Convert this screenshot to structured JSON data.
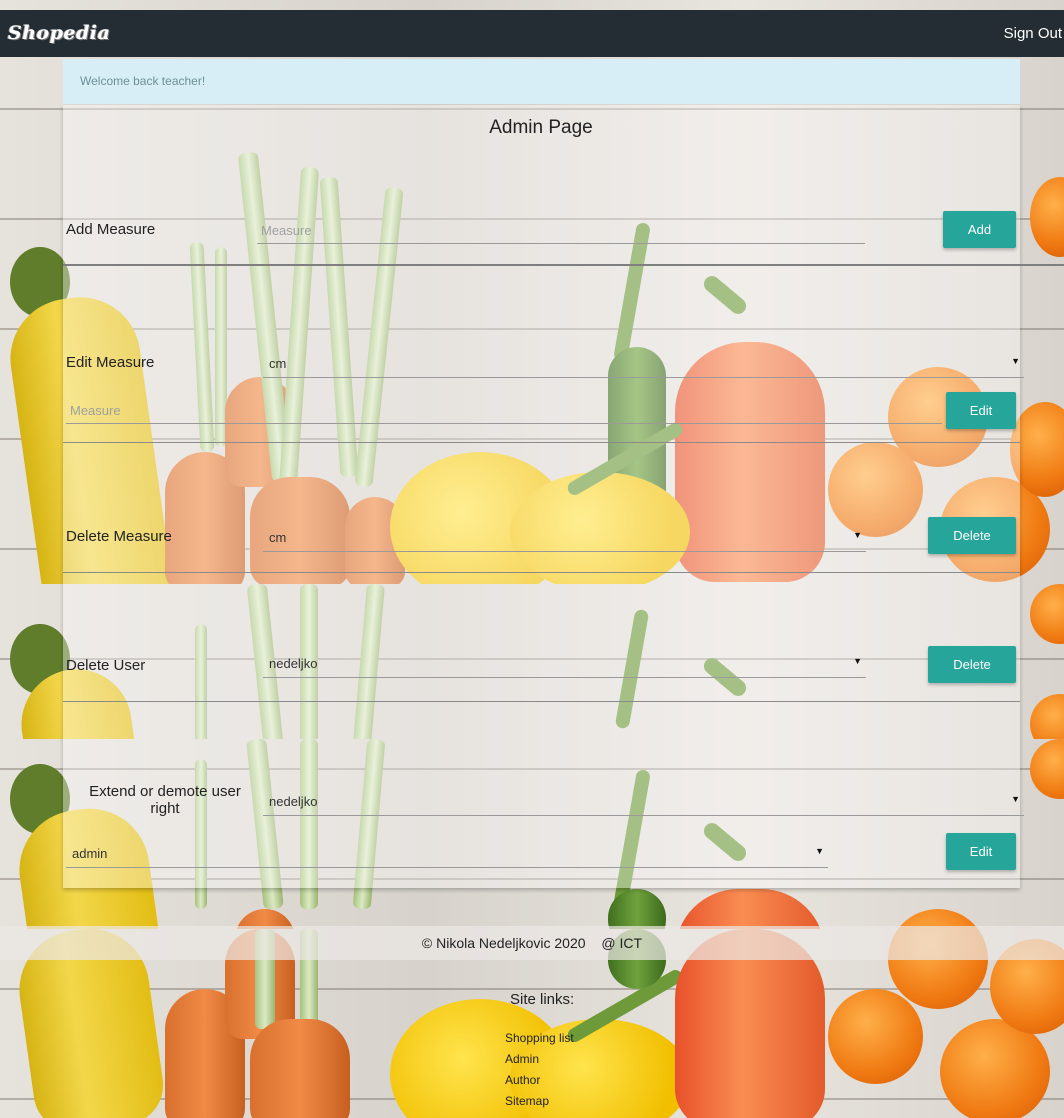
{
  "navbar": {
    "brand": "Shopedia",
    "sign_out": "Sign Out"
  },
  "alert": {
    "text": "Welcome back teacher!"
  },
  "page": {
    "title": "Admin Page"
  },
  "add_measure": {
    "label": "Add Measure",
    "placeholder": "Measure",
    "button": "Add"
  },
  "edit_measure": {
    "label": "Edit Measure",
    "selected": "cm",
    "placeholder": "Measure",
    "button": "Edit"
  },
  "delete_measure": {
    "label": "Delete Measure",
    "selected": "cm",
    "button": "Delete"
  },
  "delete_user": {
    "label": "Delete User",
    "selected": "nedeljko",
    "button": "Delete"
  },
  "user_rights": {
    "label_line1": "Extend or demote user",
    "label_line2": "right",
    "user_selected": "nedeljko",
    "role_selected": "admin",
    "button": "Edit"
  },
  "footer": {
    "copyright": "© Nikola Nedeljkovic 2020",
    "org": "@ ICT",
    "links_title": "Site links:",
    "links": [
      "Shopping list",
      "Admin",
      "Author",
      "Sitemap"
    ]
  },
  "colors": {
    "navbar": "#232d33",
    "accent": "#26a69a",
    "alert": "#d8eef6"
  },
  "icons": {
    "select_caret": "caret-down-icon"
  }
}
